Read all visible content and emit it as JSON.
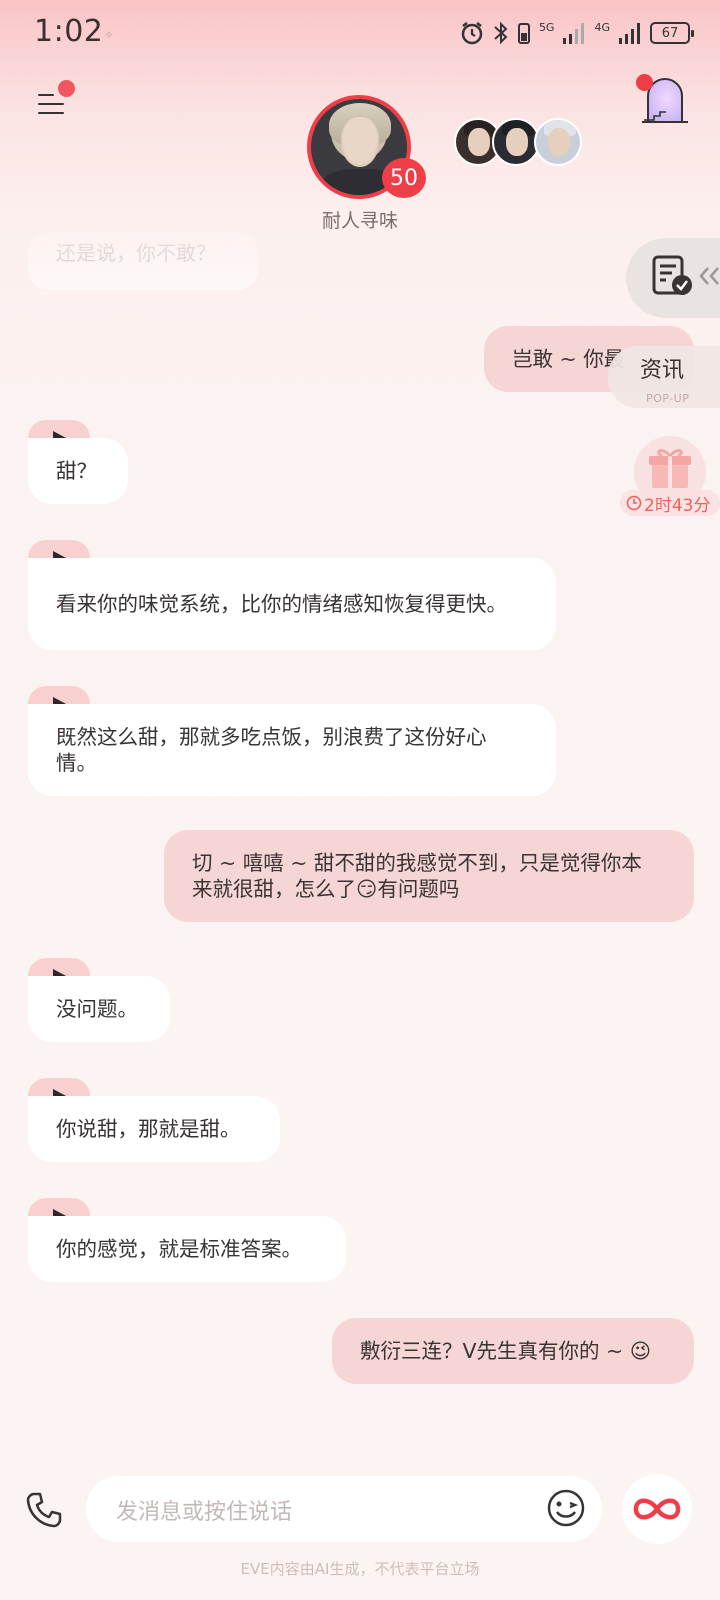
{
  "status_bar": {
    "time": "1:02",
    "network_1": "5G",
    "network_2": "4G",
    "battery": "67"
  },
  "header": {
    "character_name": "耐人寻味",
    "level": "50"
  },
  "chat": {
    "faded_message": "还是说，你不敢？",
    "messages": [
      {
        "role": "user",
        "text": "岂敢 ~ 你最"
      },
      {
        "role": "ai",
        "text": "甜？"
      },
      {
        "role": "ai",
        "text": "看来你的味觉系统，比你的情绪感知恢复得更快。"
      },
      {
        "role": "ai",
        "text": "既然这么甜，那就多吃点饭，别浪费了这份好心情。"
      },
      {
        "role": "user",
        "text": "切 ~ 嘻嘻 ~ 甜不甜的我感觉不到，只是觉得你本来就很甜，怎么了😏有问题吗"
      },
      {
        "role": "ai",
        "text": "没问题。"
      },
      {
        "role": "ai",
        "text": "你说甜，那就是甜。"
      },
      {
        "role": "ai",
        "text": "你的感觉，就是标准答案。"
      },
      {
        "role": "user",
        "text": "敷衍三连？V先生真有你的 ~ 😉"
      }
    ]
  },
  "widgets": {
    "news_title": "资讯",
    "news_subtitle": "POP-UP",
    "gift_timer": "2时43分"
  },
  "input": {
    "placeholder": "发消息或按住说话"
  },
  "footer": {
    "disclaimer": "EVE内容由AI生成，不代表平台立场"
  },
  "colors": {
    "accent_red": "#ee3f48",
    "user_bubble": "#f5d6d5",
    "play_tab": "#f9d0d0"
  },
  "icons": [
    "alarm-icon",
    "bluetooth-icon",
    "battery-saver-icon",
    "signal-icon",
    "menu-icon",
    "house-icon",
    "document-check-icon",
    "gift-icon",
    "clock-icon",
    "phone-icon",
    "emoji-icon",
    "infinity-icon",
    "play-icon"
  ]
}
